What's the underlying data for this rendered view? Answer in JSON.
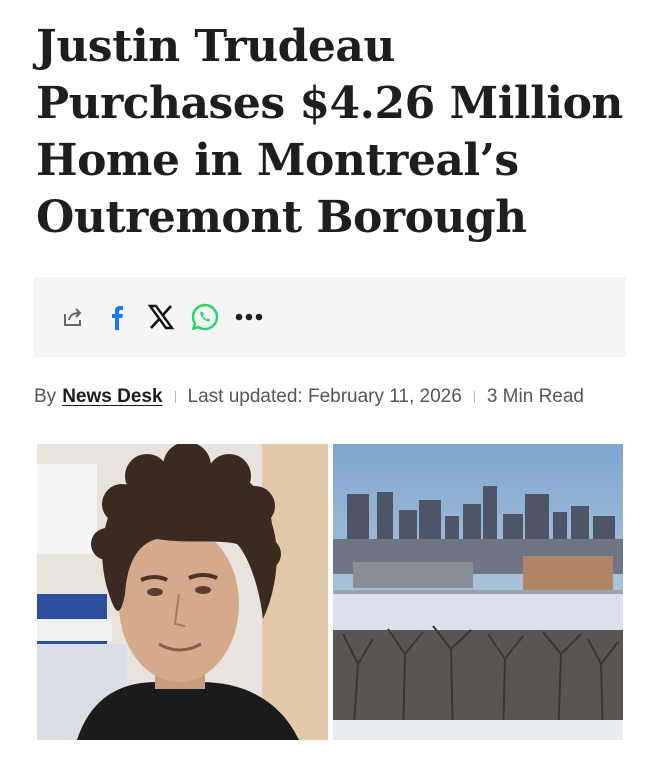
{
  "article": {
    "title": "Justin Trudeau Purchases $4.26 Million Home in Montreal’s Outremont Borough"
  },
  "share_bar": {
    "icons": [
      "share-icon",
      "facebook-icon",
      "x-icon",
      "whatsapp-icon",
      "more-icon"
    ],
    "colors": {
      "background": "#f5f5f5",
      "facebook": "#1877f2",
      "whatsapp": "#25d366"
    }
  },
  "byline": {
    "by_label": "By",
    "author": "News Desk",
    "updated_label": "Last updated: February 11, 2026",
    "read_time": "3 Min Read"
  },
  "images": {
    "left": {
      "depicts": "portrait-photo"
    },
    "right": {
      "depicts": "city-skyline-photo"
    }
  }
}
